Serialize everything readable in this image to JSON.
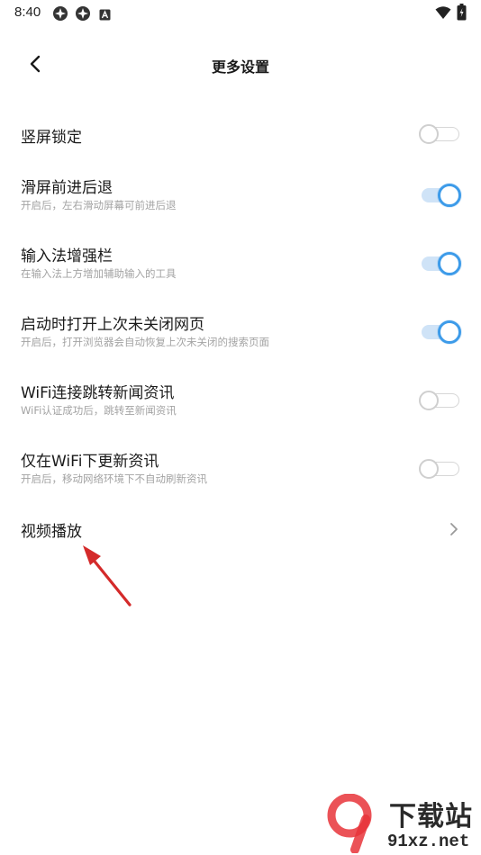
{
  "status_bar": {
    "time": "8:40",
    "icons": [
      "app-icon-1",
      "app-icon-2",
      "notification-icon",
      "wifi-icon",
      "battery-icon"
    ]
  },
  "header": {
    "back_icon": "chevron-left-icon",
    "title": "更多设置"
  },
  "settings": [
    {
      "title": "竖屏锁定",
      "description": "",
      "control": "toggle",
      "enabled": false
    },
    {
      "title": "滑屏前进后退",
      "description": "开启后，左右滑动屏幕可前进后退",
      "control": "toggle",
      "enabled": true
    },
    {
      "title": "输入法增强栏",
      "description": "在输入法上方增加辅助输入的工具",
      "control": "toggle",
      "enabled": true
    },
    {
      "title": "启动时打开上次未关闭网页",
      "description": "开启后，打开浏览器会自动恢复上次未关闭的搜索页面",
      "control": "toggle",
      "enabled": true
    },
    {
      "title": "WiFi连接跳转新闻资讯",
      "description": "WiFi认证成功后，跳转至新闻资讯",
      "control": "toggle",
      "enabled": false
    },
    {
      "title": "仅在WiFi下更新资讯",
      "description": "开启后，移动网络环境下不自动刷新资讯",
      "control": "toggle",
      "enabled": false
    },
    {
      "title": "视频播放",
      "description": "",
      "control": "chevron",
      "enabled": null
    }
  ],
  "watermark": {
    "logo_mark": "9",
    "brand_text": "下载站",
    "domain_text": "91xz.net"
  },
  "colors": {
    "accent": "#3d9be9",
    "toggle_track_on": "#cfe3f7",
    "toggle_off": "#cfcfcf",
    "secondary_text": "#a3a3a3",
    "annotation_arrow": "#d42a2a",
    "watermark_red": "#e8343a"
  }
}
